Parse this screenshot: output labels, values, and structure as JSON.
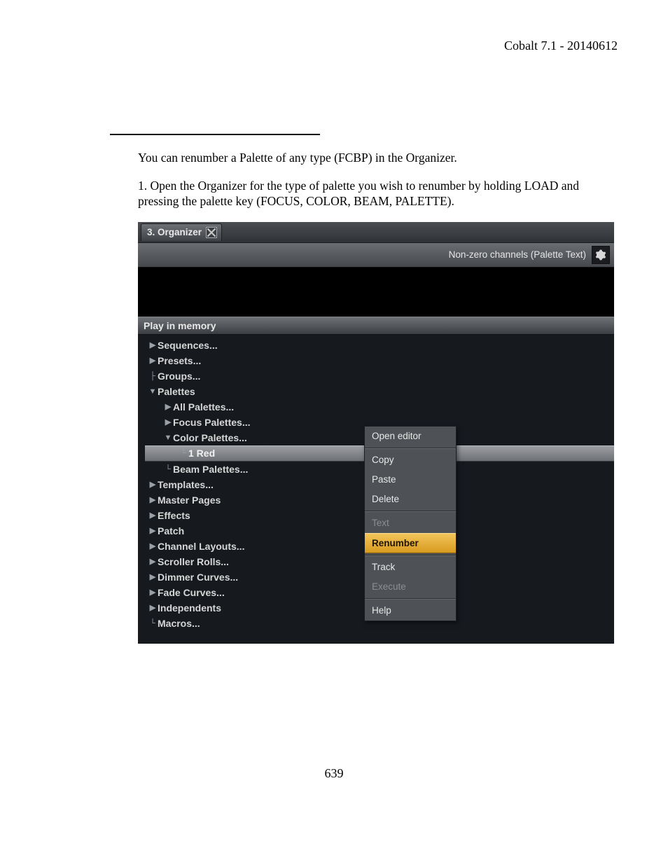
{
  "header": {
    "version": "Cobalt 7.1 - 20140612"
  },
  "body": {
    "p1": "You can renumber a Palette of any type (FCBP) in the Organizer.",
    "p2": "1. Open the Organizer for the type of palette you wish to renumber by holding LOAD and pressing the palette key (FOCUS, COLOR, BEAM, PALETTE)."
  },
  "app": {
    "tab_title": "3. Organizer",
    "toolbar_label": "Non-zero channels (Palette Text)",
    "section": "Play in memory",
    "tree": {
      "sequences": "Sequences...",
      "presets": "Presets...",
      "groups": "Groups...",
      "palettes": "Palettes",
      "all_palettes": "All Palettes...",
      "focus_palettes": "Focus Palettes...",
      "color_palettes": "Color Palettes...",
      "one_red": "1 Red",
      "beam_palettes": "Beam Palettes...",
      "templates": "Templates...",
      "master_pages": "Master Pages",
      "effects": "Effects",
      "patch": "Patch",
      "channel_layouts": "Channel Layouts...",
      "scroller_rolls": "Scroller Rolls...",
      "dimmer_curves": "Dimmer Curves...",
      "fade_curves": "Fade Curves...",
      "independents": "Independents",
      "macros": "Macros..."
    },
    "menu": {
      "open_editor": "Open editor",
      "copy": "Copy",
      "paste": "Paste",
      "delete": "Delete",
      "text": "Text",
      "renumber": "Renumber",
      "track": "Track",
      "execute": "Execute",
      "help": "Help"
    }
  },
  "page_number": "639"
}
